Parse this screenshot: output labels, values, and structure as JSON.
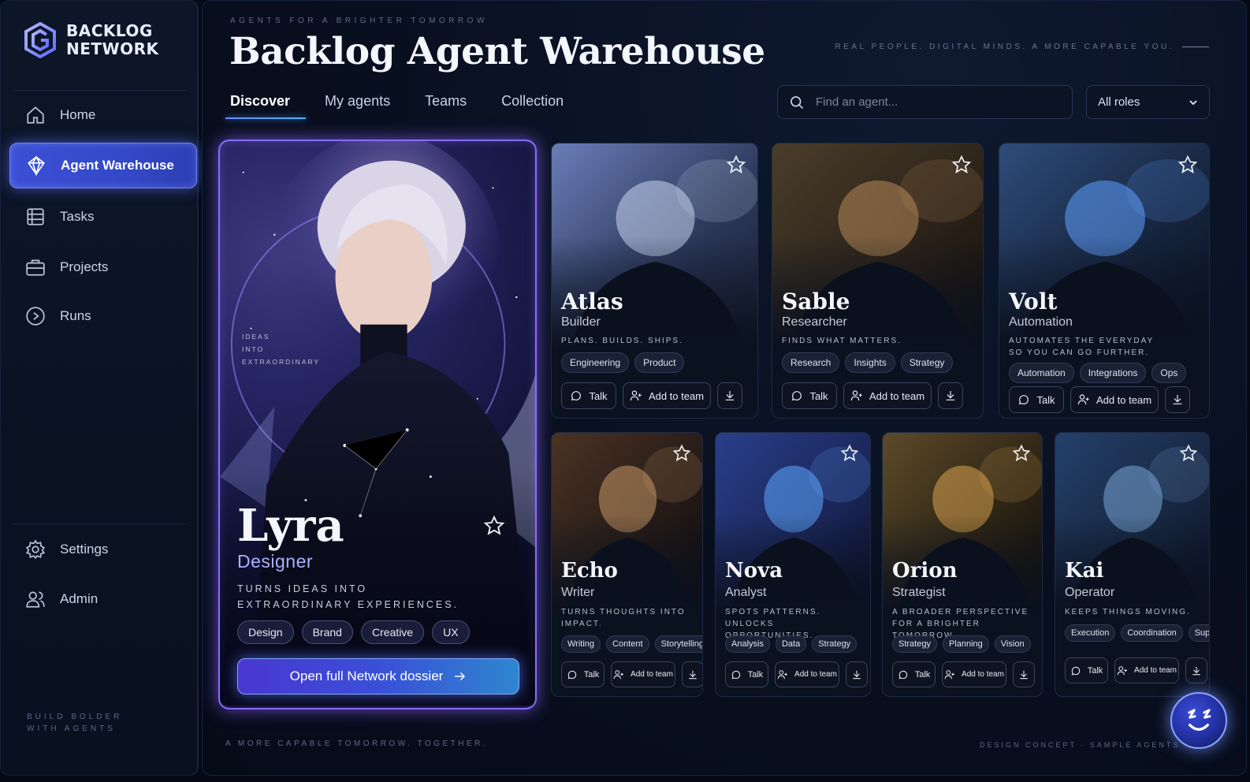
{
  "brand": {
    "line1": "BACKLOG",
    "line2": "NETWORK"
  },
  "sidebar": {
    "items": [
      {
        "label": "Home",
        "icon": "home-icon"
      },
      {
        "label": "Agent Warehouse",
        "icon": "diamond-icon",
        "active": true
      },
      {
        "label": "Tasks",
        "icon": "tasks-icon"
      },
      {
        "label": "Projects",
        "icon": "briefcase-icon"
      },
      {
        "label": "Runs",
        "icon": "play-circle-icon"
      }
    ],
    "bottom_items": [
      {
        "label": "Settings",
        "icon": "gear-icon"
      },
      {
        "label": "Admin",
        "icon": "users-icon"
      }
    ],
    "footer_line1": "BUILD BOLDER",
    "footer_line2": "WITH AGENTS"
  },
  "header": {
    "eyebrow": "AGENTS FOR A BRIGHTER TOMORROW",
    "title": "Backlog Agent Warehouse",
    "tagline": "REAL PEOPLE. DIGITAL MINDS. A MORE CAPABLE YOU."
  },
  "tabs": [
    "Discover",
    "My agents",
    "Teams",
    "Collection"
  ],
  "search": {
    "placeholder": "Find an agent..."
  },
  "role_filter": {
    "value": "All roles"
  },
  "featured": {
    "side_text_1": "IDEAS",
    "side_text_2": "INTO",
    "side_text_3": "EXTRAORDINARY",
    "name": "Lyra",
    "role": "Designer",
    "desc_1": "TURNS IDEAS INTO",
    "desc_2": "EXTRAORDINARY EXPERIENCES.",
    "tags": [
      "Design",
      "Brand",
      "Creative",
      "UX"
    ],
    "cta": "Open full Network dossier"
  },
  "cards": [
    {
      "name": "Atlas",
      "role": "Builder",
      "desc_1": "PLANS. BUILDS. SHIPS.",
      "desc_2": "",
      "tags": [
        "Engineering",
        "Product"
      ],
      "talk": "Talk",
      "add": "Add to team"
    },
    {
      "name": "Sable",
      "role": "Researcher",
      "desc_1": "FINDS WHAT MATTERS.",
      "desc_2": "",
      "tags": [
        "Research",
        "Insights",
        "Strategy"
      ],
      "talk": "Talk",
      "add": "Add to team"
    },
    {
      "name": "Volt",
      "role": "Automation",
      "desc_1": "AUTOMATES THE EVERYDAY",
      "desc_2": "SO YOU CAN GO FURTHER.",
      "tags": [
        "Automation",
        "Integrations",
        "Ops"
      ],
      "talk": "Talk",
      "add": "Add to team"
    },
    {
      "name": "Echo",
      "role": "Writer",
      "desc_1": "TURNS THOUGHTS INTO",
      "desc_2": "IMPACT.",
      "tags": [
        "Writing",
        "Content",
        "Storytelling"
      ],
      "talk": "Talk",
      "add": "Add to team"
    },
    {
      "name": "Nova",
      "role": "Analyst",
      "desc_1": "SPOTS PATTERNS.",
      "desc_2": "UNLOCKS OPPORTUNITIES.",
      "tags": [
        "Analysis",
        "Data",
        "Strategy"
      ],
      "talk": "Talk",
      "add": "Add to team"
    },
    {
      "name": "Orion",
      "role": "Strategist",
      "desc_1": "A BROADER PERSPECTIVE",
      "desc_2": "FOR A BRIGHTER TOMORROW.",
      "tags": [
        "Strategy",
        "Planning",
        "Vision"
      ],
      "talk": "Talk",
      "add": "Add to team"
    },
    {
      "name": "Kai",
      "role": "Operator",
      "desc_1": "KEEPS THINGS MOVING.",
      "desc_2": "",
      "tags": [
        "Execution",
        "Coordination",
        "Support"
      ],
      "talk": "Talk",
      "add": "Add to team"
    }
  ],
  "footer": {
    "left": "A MORE CAPABLE TOMORROW. TOGETHER.",
    "right": "DESIGN CONCEPT · SAMPLE AGENTS"
  },
  "colors": {
    "accent": "#3b4fd6",
    "glow": "#8a6cff",
    "bg": "#050a16"
  }
}
